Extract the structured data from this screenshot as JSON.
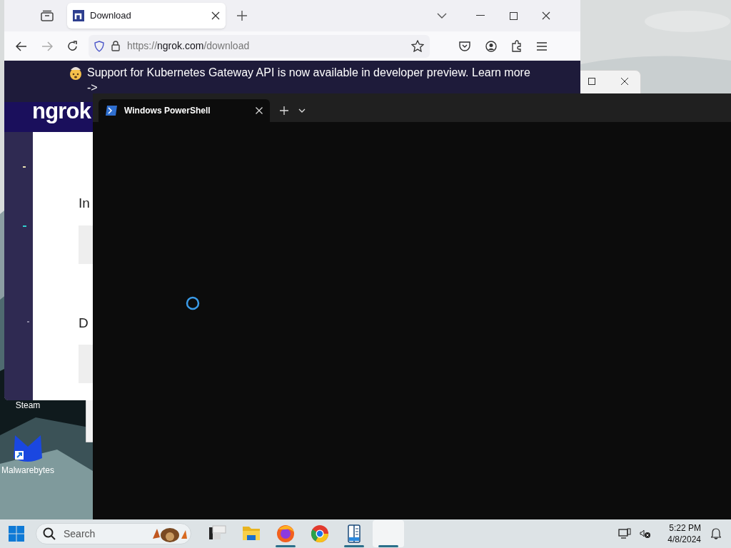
{
  "desktop": {
    "icons": [
      {
        "label": "Steam"
      },
      {
        "label": "Malwarebytes"
      }
    ]
  },
  "browser": {
    "tab": {
      "title": "Download",
      "selected": true
    },
    "url_parts": [
      "https://",
      "ngrok.com",
      "/download"
    ],
    "banner": "Support for Kubernetes Gateway API is now available in developer preview. Learn more ->",
    "logo": "ngrok",
    "headings": [
      "In",
      "D"
    ]
  },
  "terminal": {
    "tabs": [
      {
        "title": "Windows PowerShell",
        "selected": true
      }
    ]
  },
  "taskbar": {
    "search": {
      "placeholder": "Search"
    },
    "apps": [
      {
        "kind": "stack",
        "running": false,
        "selected": false
      },
      {
        "kind": "folder",
        "running": false,
        "selected": false
      },
      {
        "kind": "firefox",
        "running": true,
        "selected": false
      },
      {
        "kind": "chrome",
        "running": false,
        "selected": false
      },
      {
        "kind": "reader",
        "running": true,
        "selected": false
      },
      {
        "kind": "blank",
        "running": true,
        "selected": true
      }
    ],
    "time": "5:22 PM",
    "date": "4/8/2024"
  }
}
